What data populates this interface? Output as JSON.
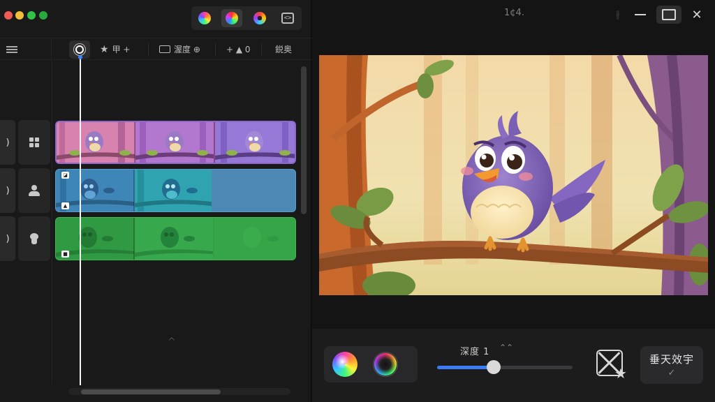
{
  "left_toolbar": {
    "tool2_label": "甲 +",
    "tool3_label": "渥度 ⊕",
    "tool4_label": "+ ▲ 0",
    "tool5_label": "鋭奥"
  },
  "tracks": [
    {
      "side_label": ")",
      "head_icon": "grid-icon",
      "clip_color": "#b85db0"
    },
    {
      "side_label": ")",
      "head_icon": "person-icon",
      "clip_color": "#4e88b5"
    },
    {
      "side_label": ")",
      "head_icon": "head-icon",
      "clip_color": "#33a046"
    }
  ],
  "right_panel": {
    "title": "1¢4.",
    "pin_label": "∦",
    "close_label": "✕"
  },
  "controls": {
    "depth_label": "深度 1",
    "depth_chevron": "⌃⌃",
    "slider_value": 0.42,
    "apply_label": "垂天效宇",
    "apply_check": "✓"
  },
  "colors": {
    "accent": "#3b7bf6",
    "playhead": "#f5f5f5"
  }
}
